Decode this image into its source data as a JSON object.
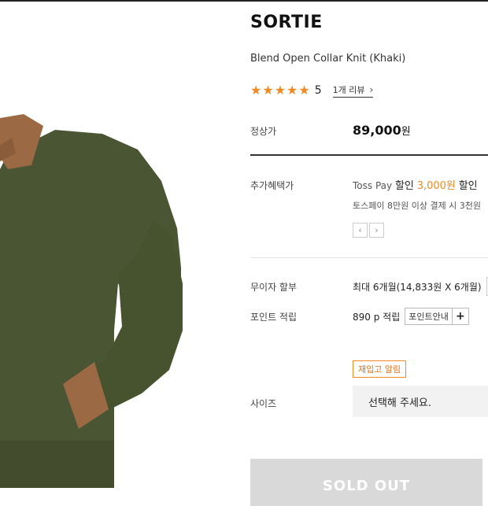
{
  "brand": "SORTIE",
  "product_name": "Blend Open Collar Knit (Khaki)",
  "rating": {
    "stars": 5,
    "value": "5",
    "review_link": "1개 리뷰"
  },
  "price": {
    "label": "정상가",
    "amount": "89,000",
    "unit": "원"
  },
  "benefits": {
    "label": "추가혜택가",
    "provider": "Toss Pay",
    "discount_prefix": "할인",
    "discount_amount": "3,000원",
    "discount_suffix": "할인",
    "note": "토스페이 8만원 이상 결제 시 3천원"
  },
  "installment": {
    "label": "무이자 할부",
    "value": "최대 6개월(14,833원 X 6개월)"
  },
  "points": {
    "label": "포인트 적립",
    "value": "890 p 적립",
    "guide_button": "포인트안내",
    "plus_button": "+"
  },
  "restock_button": "재입고 알림",
  "size": {
    "label": "사이즈",
    "placeholder": "선택해 주세요."
  },
  "sold_out_button": "SOLD OUT",
  "colors": {
    "accent": "#f08a24",
    "sweater": "#4a5534",
    "collar": "#9b6a45"
  }
}
